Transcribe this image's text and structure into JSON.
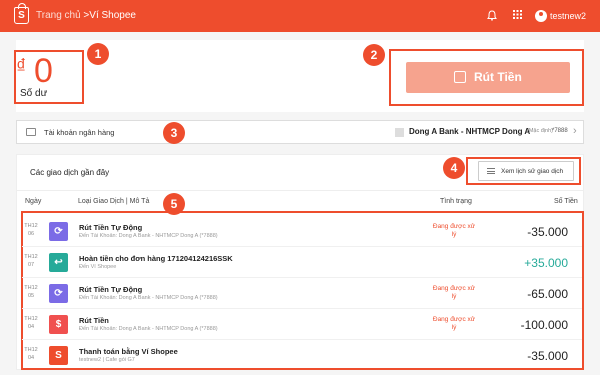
{
  "header": {
    "breadcrumb_home": "Trang chủ",
    "breadcrumb_sep": " >",
    "breadcrumb_current": "Ví Shopee",
    "username": "testnew2",
    "logo_letter": "S"
  },
  "balance": {
    "currency_symbol": "₫",
    "amount": "0",
    "label": "Số dư"
  },
  "withdraw_button": {
    "label": "Rút Tiền"
  },
  "bank": {
    "label": "Tài khoản ngân hàng",
    "name": "Dong A Bank - NHTMCP Dong A",
    "default_tag": "(Mặc định)",
    "number": "*7888"
  },
  "transactions": {
    "title": "Các giao dịch gần đây",
    "history_button": "Xem lịch sử giao dịch",
    "columns": {
      "date": "Ngày",
      "type": "Loại Giao Dịch | Mô Tả",
      "status": "Tình trạng",
      "amount": "Số Tiền"
    },
    "rows": [
      {
        "month": "TH12",
        "day": "06",
        "icon": "withdraw-cycle-icon",
        "icon_color": "#7b6be6",
        "icon_glyph": "⟳",
        "name": "Rút Tiền Tự Động",
        "desc": "Đến Tài Khoản: Dong A Bank - NHTMCP Dong A (*7888)",
        "status": "Đang được xử lý",
        "amount": "-35.000",
        "amount_color": "#222222"
      },
      {
        "month": "TH12",
        "day": "07",
        "icon": "refund-icon",
        "icon_color": "#26aa99",
        "icon_glyph": "↩",
        "name": "Hoàn tiền cho đơn hàng 171204124216SSK",
        "desc": "Đến Ví Shopee",
        "status": "",
        "amount": "+35.000",
        "amount_color": "#26aa99"
      },
      {
        "month": "TH12",
        "day": "05",
        "icon": "withdraw-cycle-icon",
        "icon_color": "#7b6be6",
        "icon_glyph": "⟳",
        "name": "Rút Tiền Tự Động",
        "desc": "Đến Tài Khoản: Dong A Bank - NHTMCP Dong A (*7888)",
        "status": "Đang được xử lý",
        "amount": "-65.000",
        "amount_color": "#222222"
      },
      {
        "month": "TH12",
        "day": "04",
        "icon": "money-bag-icon",
        "icon_color": "#f0504f",
        "icon_glyph": "$",
        "name": "Rút Tiền",
        "desc": "Đến Tài Khoản: Dong A Bank - NHTMCP Dong A (*7888)",
        "status": "Đang được xử lý",
        "amount": "-100.000",
        "amount_color": "#222222"
      },
      {
        "month": "TH12",
        "day": "04",
        "icon": "shopee-bag-icon",
        "icon_color": "#ee4d2d",
        "icon_glyph": "S",
        "name": "Thanh toán bằng Ví Shopee",
        "desc": "testnew2 | Cafe gói G7",
        "status": "",
        "amount": "-35.000",
        "amount_color": "#222222"
      }
    ]
  },
  "annotations": [
    "1",
    "2",
    "3",
    "4",
    "5"
  ],
  "colors": {
    "accent": "#ee4d2d",
    "withdraw_disabled": "#f6a38e"
  }
}
